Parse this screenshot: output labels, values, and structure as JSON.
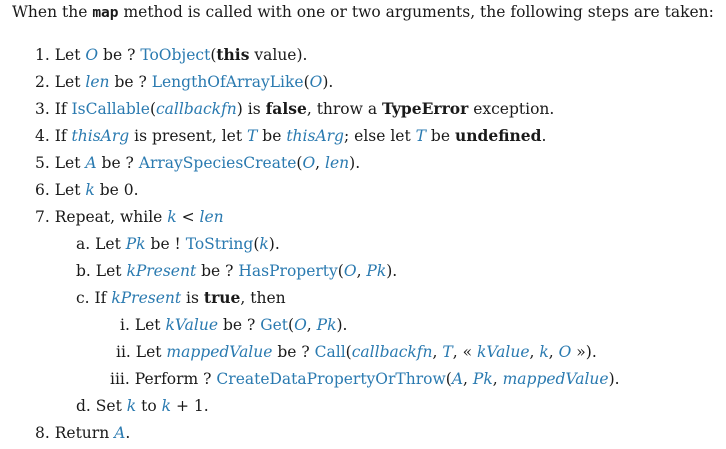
{
  "intro": {
    "before": "When the ",
    "method": "map",
    "after": " method is called with one or two arguments, the following steps are taken:"
  },
  "steps": [
    {
      "marker": "1.",
      "text": "Let O be ? ToObject(this value)."
    },
    {
      "marker": "2.",
      "text": "Let len be ? LengthOfArrayLike(O)."
    },
    {
      "marker": "3.",
      "text": "If IsCallable(callbackfn) is false, throw a TypeError exception."
    },
    {
      "marker": "4.",
      "text": "If thisArg is present, let T be thisArg; else let T be undefined."
    },
    {
      "marker": "5.",
      "text": "Let A be ? ArraySpeciesCreate(O, len)."
    },
    {
      "marker": "6.",
      "text": "Let k be 0."
    },
    {
      "marker": "7.",
      "text": "Repeat, while k < len"
    },
    {
      "marker": "a.",
      "text": "Let Pk be ! ToString(k)."
    },
    {
      "marker": "b.",
      "text": "Let kPresent be ? HasProperty(O, Pk)."
    },
    {
      "marker": "c.",
      "text": "If kPresent is true, then"
    },
    {
      "marker": "i.",
      "text": "Let kValue be ? Get(O, Pk)."
    },
    {
      "marker": "ii.",
      "text": "Let mappedValue be ? Call(callbackfn, T, « kValue, k, O »)."
    },
    {
      "marker": "iii.",
      "text": "Perform ? CreateDataPropertyOrThrow(A, Pk, mappedValue)."
    },
    {
      "marker": "d.",
      "text": "Set k to k + 1."
    },
    {
      "marker": "8.",
      "text": "Return A."
    }
  ],
  "colors": {
    "link": "#2a7ab0",
    "text": "#1a1a1a"
  }
}
